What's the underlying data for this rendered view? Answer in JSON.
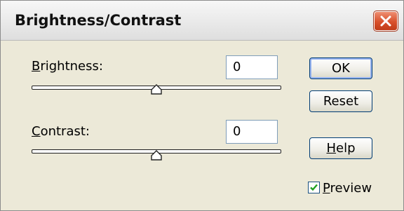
{
  "window": {
    "title": "Brightness/Contrast",
    "close_icon": "close-icon"
  },
  "brightness": {
    "label_accel": "B",
    "label_rest": "rightness:",
    "value": "0",
    "slider_level": 0.5
  },
  "contrast": {
    "label_accel": "C",
    "label_rest": "ontrast:",
    "value": "0",
    "slider_level": 0.5
  },
  "buttons": {
    "ok": "OK",
    "reset": "Reset",
    "help_accel": "H",
    "help_rest": "elp"
  },
  "preview": {
    "label_accel": "P",
    "label_rest": "review",
    "checked": true
  },
  "colors": {
    "dialog_bg": "#ece9d8",
    "close_button": "#d8502b",
    "check_mark": "#21a121"
  }
}
